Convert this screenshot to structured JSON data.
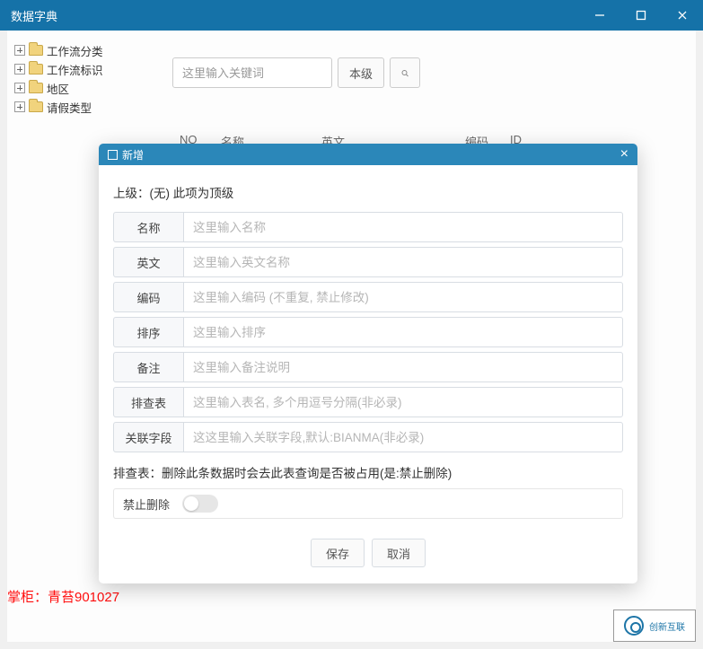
{
  "window": {
    "title": "数据字典"
  },
  "sidebar": {
    "items": [
      {
        "label": "工作流分类"
      },
      {
        "label": "工作流标识"
      },
      {
        "label": "地区"
      },
      {
        "label": "请假类型"
      }
    ]
  },
  "search": {
    "placeholder": "这里输入关键词",
    "level_button": "本级"
  },
  "table": {
    "headers": {
      "no": "NO",
      "name": "名称",
      "english": "英文",
      "code": "编码",
      "id": "ID"
    }
  },
  "modal": {
    "title": "新增",
    "parent_line": "上级：(无) 此项为顶级",
    "fields": {
      "name": {
        "label": "名称",
        "placeholder": "这里输入名称"
      },
      "english": {
        "label": "英文",
        "placeholder": "这里输入英文名称"
      },
      "code": {
        "label": "编码",
        "placeholder": "这里输入编码 (不重复, 禁止修改)"
      },
      "order": {
        "label": "排序",
        "placeholder": "这里输入排序"
      },
      "remark": {
        "label": "备注",
        "placeholder": "这里输入备注说明"
      },
      "exclude_table": {
        "label": "排查表",
        "placeholder": "这里输入表名, 多个用逗号分隔(非必录)"
      },
      "relation_field": {
        "label": "关联字段",
        "placeholder": "这这里输入关联字段,默认:BIANMA(非必录)"
      }
    },
    "hint": "排查表：删除此条数据时会去此表查询是否被占用(是:禁止删除)",
    "forbid_delete": "禁止删除",
    "save": "保存",
    "cancel": "取消"
  },
  "footer": {
    "text": "掌柜：青苔901027",
    "logo_text": "创新互联"
  }
}
